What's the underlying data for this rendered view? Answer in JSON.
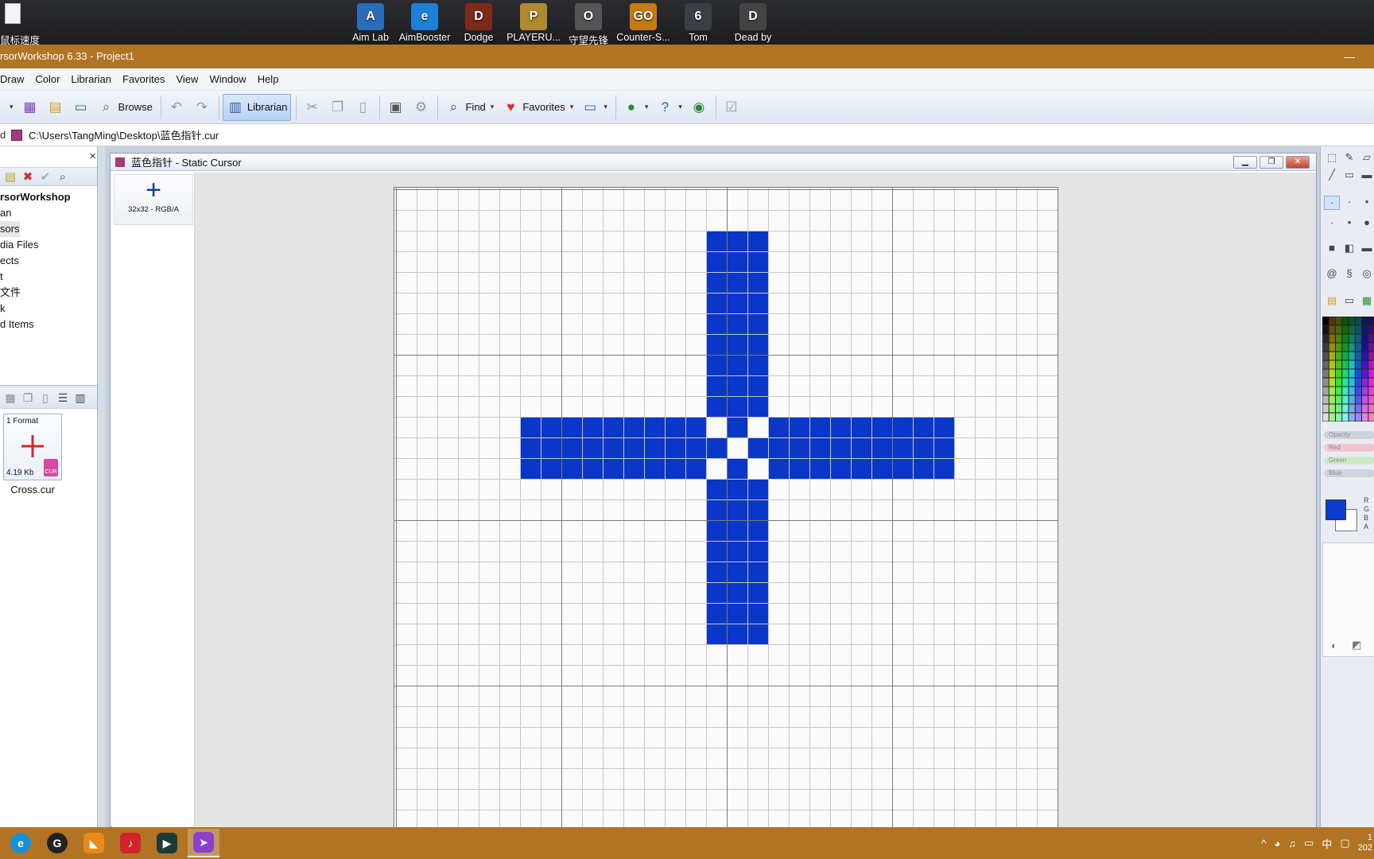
{
  "desktop": {
    "top_left_label": "鼠标速度",
    "icons": [
      {
        "label": "Aim Lab",
        "glyph": "A",
        "color": "#2a6cb8"
      },
      {
        "label": "AimBooster",
        "glyph": "e",
        "color": "#1d7fd6"
      },
      {
        "label": "Dodge",
        "glyph": "D",
        "color": "#7c2a1a"
      },
      {
        "label": "PLAYERU...",
        "glyph": "P",
        "color": "#b08a2e"
      },
      {
        "label": "守望先锋",
        "glyph": "O",
        "color": "#555"
      },
      {
        "label": "Counter-S...",
        "glyph": "GO",
        "color": "#c57a12"
      },
      {
        "label": "Tom",
        "glyph": "6",
        "color": "#3a3f46"
      },
      {
        "label": "Dead by",
        "glyph": "D",
        "color": "#444"
      }
    ]
  },
  "app": {
    "title": "rsorWorkshop 6.33 - Project1",
    "minimize_glyph": "—"
  },
  "menu": [
    "Draw",
    "Color",
    "Librarian",
    "Favorites",
    "View",
    "Window",
    "Help"
  ],
  "toolbar": {
    "browse": "Browse",
    "librarian": "Librarian",
    "find": "Find",
    "favorites": "Favorites"
  },
  "pathbar": {
    "left": "d",
    "path": "C:\\Users\\TangMing\\Desktop\\蓝色指针.cur"
  },
  "leftpane": {
    "close": "×",
    "tree": [
      "rsorWorkshop",
      "an",
      "sors",
      "dia Files",
      "ects",
      "t",
      "文件",
      "k",
      "d Items"
    ],
    "file": {
      "format": "1 Format",
      "size": "4.19 Kb",
      "badge": "CUR",
      "name": "Cross.cur"
    }
  },
  "document": {
    "title": "蓝色指针 - Static Cursor",
    "format_label": "32x32 - RGB/A",
    "format_glyph": "+",
    "cursor_color": "#0a37c8",
    "grid_size": 32
  },
  "rightpane": {
    "sliders": [
      "Opacity",
      "Red",
      "Green",
      "Blue"
    ],
    "rgba": [
      "R",
      "G",
      "B",
      "A"
    ],
    "fg_color": "#0b3bd0"
  },
  "taskbar": {
    "tray_ime": "中",
    "clock_top": "1",
    "clock_bottom": "202"
  }
}
